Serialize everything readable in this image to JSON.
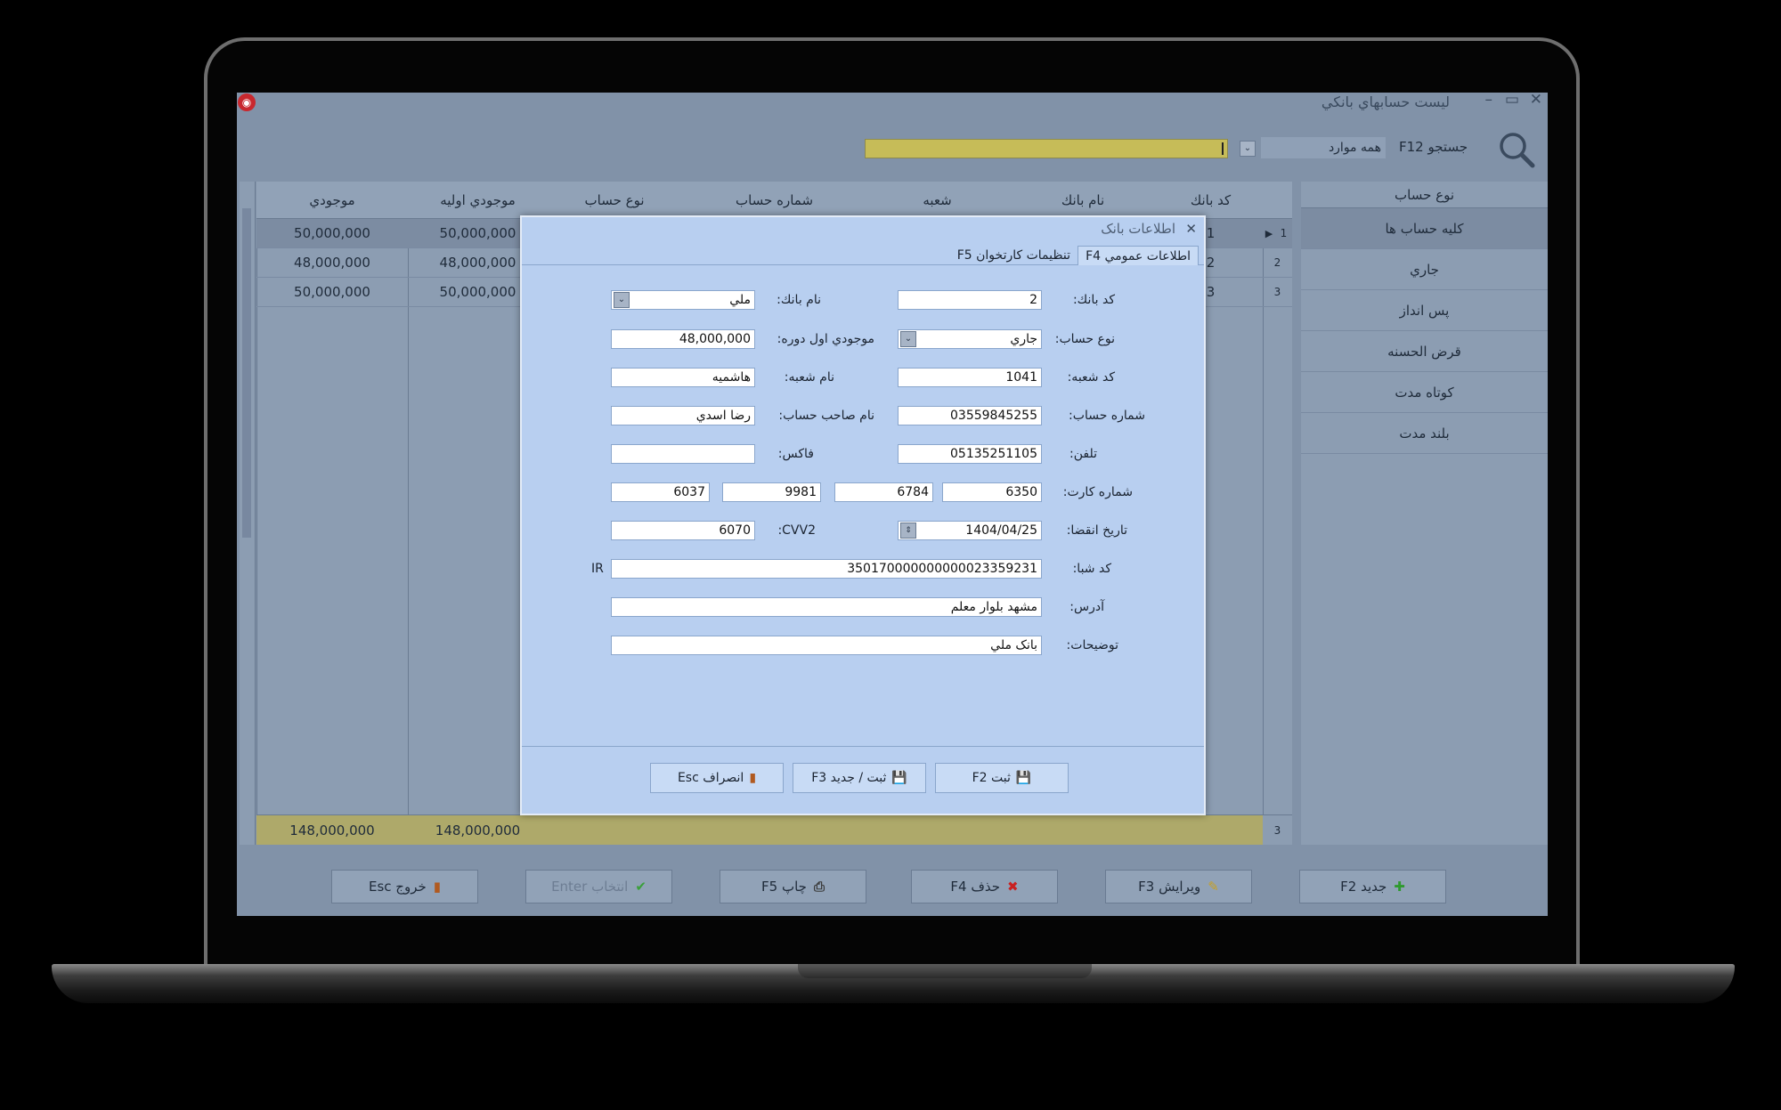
{
  "window": {
    "title": "ليست حسابهاي بانكي",
    "minimize": "–",
    "restore": "▭",
    "close": "✕",
    "logo": "◉"
  },
  "search": {
    "label": "جستجو F12",
    "scope": "همه موارد",
    "dropdown_glyph": "⌄"
  },
  "grid": {
    "columns": [
      "كد بانك",
      "نام بانك",
      "شعبه",
      "شماره حساب",
      "نوع حساب",
      "موجودي اوليه",
      "موجودي"
    ],
    "rows": [
      {
        "row_no": "1",
        "bank_code": "1",
        "initial": "50,000,000",
        "balance": "50,000,000",
        "marker": "▶"
      },
      {
        "row_no": "2",
        "bank_code": "2",
        "initial": "48,000,000",
        "balance": "48,000,000"
      },
      {
        "row_no": "3",
        "bank_code": "3",
        "initial": "50,000,000",
        "balance": "50,000,000"
      }
    ],
    "footer": {
      "count": "3",
      "initial_total": "148,000,000",
      "balance_total": "148,000,000"
    }
  },
  "sidebar": {
    "header": "نوع حساب",
    "items": [
      "كليه حساب ها",
      "جاري",
      "پس انداز",
      "قرض الحسنه",
      "كوتاه مدت",
      "بلند مدت"
    ]
  },
  "toolbar": {
    "new": "جديد F2",
    "edit": "ويرايش F3",
    "delete": "حذف F4",
    "print": "چاپ F5",
    "select": "انتخاب Enter",
    "exit": "خروج Esc"
  },
  "dialog": {
    "title": "اطلاعات بانک",
    "tabs": [
      "اطلاعات عمومي F4",
      "تنظيمات كارتخوان F5"
    ],
    "labels": {
      "bank_code": "كد بانك:",
      "bank_name": "نام بانك:",
      "account_type": "نوع حساب:",
      "opening_balance": "موجودي اول دوره:",
      "branch_code": "كد شعبه:",
      "branch_name": "نام شعبه:",
      "account_number": "شماره حساب:",
      "owner_name": "نام صاحب حساب:",
      "phone": "تلفن:",
      "fax": "فاكس:",
      "card_number": "شماره كارت:",
      "expiry": "تاريخ انقضا:",
      "cvv2": "CVV2:",
      "sheba": "كد شبا:",
      "address": "آدرس:",
      "notes": "توضيحات:"
    },
    "values": {
      "bank_code": "2",
      "bank_name": "ملي",
      "account_type": "جاري",
      "opening_balance": "48,000,000",
      "branch_code": "1041",
      "branch_name": "هاشميه",
      "account_number": "03559845255",
      "owner_name": "رضا اسدي",
      "phone": "05135251105",
      "fax": "",
      "card_1": "6350",
      "card_2": "6784",
      "card_3": "9981",
      "card_4": "6037",
      "expiry": "1404/04/25",
      "cvv2": "6070",
      "sheba": "350170000000000023359231",
      "sheba_prefix": "IR",
      "address": "مشهد بلوار معلم",
      "notes": "بانک ملي"
    },
    "buttons": {
      "save": "ثبت F2",
      "save_new": "ثبت / جديد F3",
      "cancel": "انصراف Esc"
    }
  }
}
